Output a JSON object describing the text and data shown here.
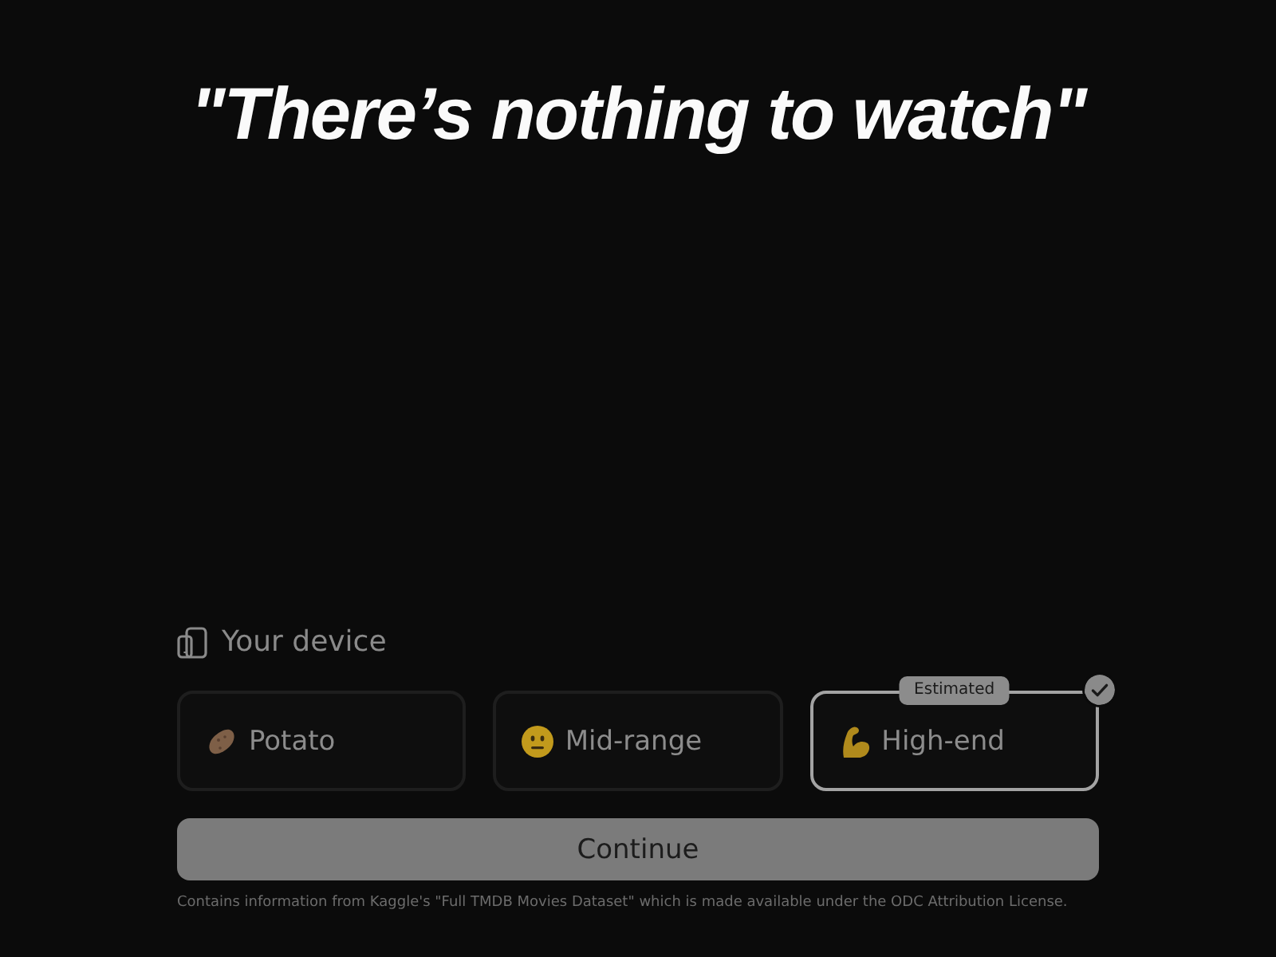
{
  "title": "\"There’s nothing to watch\"",
  "device": {
    "label": "Your device",
    "options": [
      {
        "kind": "low",
        "label": "Potato",
        "selected": false
      },
      {
        "kind": "mid",
        "label": "Mid-range",
        "selected": false
      },
      {
        "kind": "high",
        "label": "High-end",
        "selected": true,
        "badge": "Estimated"
      }
    ]
  },
  "continue_button": {
    "label": "Continue"
  },
  "footer": "Contains information from Kaggle's \"Full TMDB Movies Dataset\" which is made available under the ODC Attribution License."
}
